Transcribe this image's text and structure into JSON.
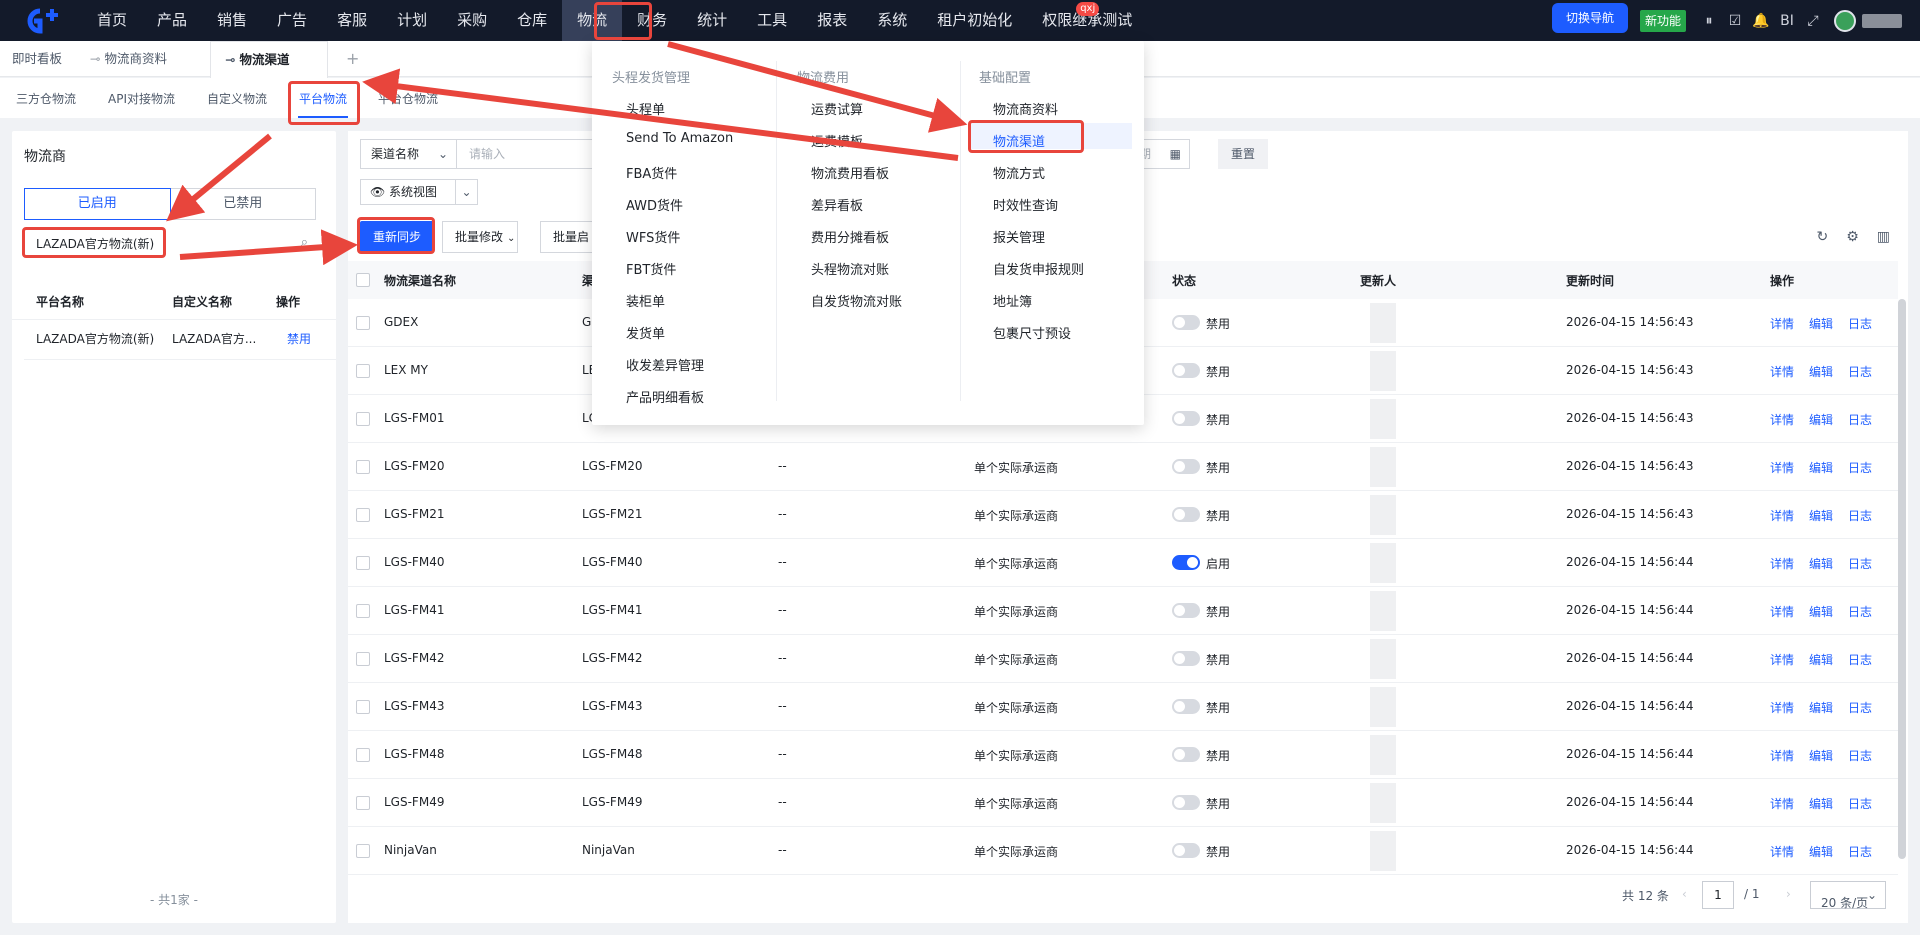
{
  "topnav": {
    "items": [
      "首页",
      "产品",
      "销售",
      "广告",
      "客服",
      "计划",
      "采购",
      "仓库",
      "物流",
      "财务",
      "统计",
      "工具",
      "报表",
      "系统",
      "租户初始化",
      "权限继承测试"
    ],
    "active_index": 8,
    "badge": "qxj",
    "switch_nav": "切换导航",
    "new_feature": "新功能",
    "bi": "BI",
    "icons": [
      "pause-icon",
      "check-square-icon",
      "bell-icon",
      "bi-text",
      "fullscreen-icon"
    ]
  },
  "tabs": [
    {
      "label": "即时看板",
      "pinned": false
    },
    {
      "label": "物流商资料",
      "pinned": true
    },
    {
      "label": "物流渠道",
      "pinned": true,
      "active": true
    }
  ],
  "subtabs": [
    {
      "label": "三方仓物流"
    },
    {
      "label": "API对接物流"
    },
    {
      "label": "自定义物流"
    },
    {
      "label": "平台物流",
      "active": true
    },
    {
      "label": "平台仓物流"
    }
  ],
  "left_panel": {
    "title": "物流商",
    "seg_on": "已启用",
    "seg_off": "已禁用",
    "search_value": "LAZADA官方物流(新)",
    "headers": [
      "平台名称",
      "自定义名称",
      "操作"
    ],
    "row": [
      "LAZADA官方物流(新)",
      "LAZADA官方...",
      "禁用"
    ],
    "footer": "- 共1家 -"
  },
  "filters": {
    "field": "渠道名称",
    "placeholder": "请输入",
    "date_fragment": "期",
    "reset": "重置",
    "view": "系统视图"
  },
  "actions": {
    "sync": "重新同步",
    "batch_modify": "批量修改",
    "batch_enable": "批量启用"
  },
  "table": {
    "headers": [
      "物流渠道名称",
      "渠",
      "状态",
      "更新人",
      "更新时间",
      "操作"
    ],
    "rows": [
      {
        "name": "GDEX",
        "code": "GI",
        "desc": "",
        "carrier": "",
        "enabled": false,
        "status": "禁用",
        "time": "2026-04-15 14:56:43"
      },
      {
        "name": "LEX MY",
        "code": "LE",
        "desc": "",
        "carrier": "",
        "enabled": false,
        "status": "禁用",
        "time": "2026-04-15 14:56:43"
      },
      {
        "name": "LGS-FM01",
        "code": "LC",
        "desc": "",
        "carrier": "",
        "enabled": false,
        "status": "禁用",
        "time": "2026-04-15 14:56:43"
      },
      {
        "name": "LGS-FM20",
        "code": "LGS-FM20",
        "desc": "--",
        "carrier": "单个实际承运商",
        "enabled": false,
        "status": "禁用",
        "time": "2026-04-15 14:56:43"
      },
      {
        "name": "LGS-FM21",
        "code": "LGS-FM21",
        "desc": "--",
        "carrier": "单个实际承运商",
        "enabled": false,
        "status": "禁用",
        "time": "2026-04-15 14:56:43"
      },
      {
        "name": "LGS-FM40",
        "code": "LGS-FM40",
        "desc": "--",
        "carrier": "单个实际承运商",
        "enabled": true,
        "status": "启用",
        "time": "2026-04-15 14:56:44"
      },
      {
        "name": "LGS-FM41",
        "code": "LGS-FM41",
        "desc": "--",
        "carrier": "单个实际承运商",
        "enabled": false,
        "status": "禁用",
        "time": "2026-04-15 14:56:44"
      },
      {
        "name": "LGS-FM42",
        "code": "LGS-FM42",
        "desc": "--",
        "carrier": "单个实际承运商",
        "enabled": false,
        "status": "禁用",
        "time": "2026-04-15 14:56:44"
      },
      {
        "name": "LGS-FM43",
        "code": "LGS-FM43",
        "desc": "--",
        "carrier": "单个实际承运商",
        "enabled": false,
        "status": "禁用",
        "time": "2026-04-15 14:56:44"
      },
      {
        "name": "LGS-FM48",
        "code": "LGS-FM48",
        "desc": "--",
        "carrier": "单个实际承运商",
        "enabled": false,
        "status": "禁用",
        "time": "2026-04-15 14:56:44"
      },
      {
        "name": "LGS-FM49",
        "code": "LGS-FM49",
        "desc": "--",
        "carrier": "单个实际承运商",
        "enabled": false,
        "status": "禁用",
        "time": "2026-04-15 14:56:44"
      },
      {
        "name": "NinjaVan",
        "code": "NinjaVan",
        "desc": "--",
        "carrier": "单个实际承运商",
        "enabled": false,
        "status": "禁用",
        "time": "2026-04-15 14:56:44"
      }
    ],
    "row_actions": [
      "详情",
      "编辑",
      "日志"
    ]
  },
  "pagination": {
    "total": "共 12 条",
    "page": "1",
    "of": "/ 1",
    "page_size": "20 条/页"
  },
  "dropdown": {
    "columns": [
      {
        "title": "头程发货管理",
        "items": [
          "头程单",
          "Send To Amazon",
          "FBA货件",
          "AWD货件",
          "WFS货件",
          "FBT货件",
          "装柜单",
          "发货单",
          "收发差异管理",
          "产品明细看板"
        ]
      },
      {
        "title": "物流费用",
        "items": [
          "运费试算",
          "运费模板",
          "物流费用看板",
          "差异看板",
          "费用分摊看板",
          "头程物流对账",
          "自发货物流对账"
        ]
      },
      {
        "title": "基础配置",
        "items": [
          "物流商资料",
          "物流渠道",
          "物流方式",
          "时效性查询",
          "报关管理",
          "自发货申报规则",
          "地址簿",
          "包裹尺寸预设"
        ],
        "selected_index": 1
      }
    ]
  },
  "colors": {
    "nav_bg": "#131a2a",
    "accent": "#1d5cff",
    "annotation": "#e8453c",
    "new_feature": "#26a74a"
  }
}
